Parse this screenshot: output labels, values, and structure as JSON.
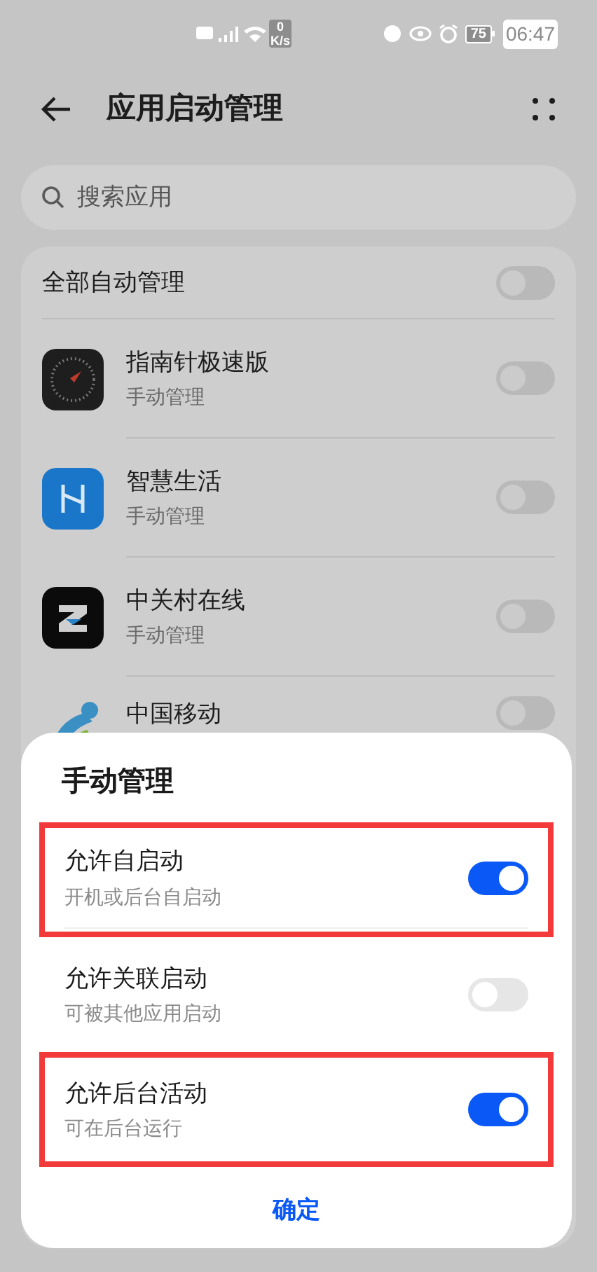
{
  "status_bar": {
    "net_speed_value": "0",
    "net_speed_unit": "K/s",
    "battery": "75",
    "time": "06:47"
  },
  "header": {
    "title": "应用启动管理"
  },
  "search": {
    "placeholder": "搜索应用"
  },
  "all_auto": {
    "label": "全部自动管理",
    "on": false
  },
  "apps": [
    {
      "kind": "compass",
      "name": "指南针极速版",
      "mode": "手动管理",
      "on": false
    },
    {
      "kind": "smartlife",
      "name": "智慧生活",
      "mode": "手动管理",
      "on": false
    },
    {
      "kind": "zol",
      "name": "中关村在线",
      "mode": "手动管理",
      "on": false
    },
    {
      "kind": "mobile",
      "name": "中国移动",
      "on": false
    }
  ],
  "dialog": {
    "title": "手动管理",
    "options": [
      {
        "title": "允许自启动",
        "subtitle": "开机或后台自启动",
        "on": true,
        "highlighted": true
      },
      {
        "title": "允许关联启动",
        "subtitle": "可被其他应用启动",
        "on": false,
        "highlighted": false
      },
      {
        "title": "允许后台活动",
        "subtitle": "可在后台运行",
        "on": true,
        "highlighted": true
      }
    ],
    "confirm": "确定"
  }
}
